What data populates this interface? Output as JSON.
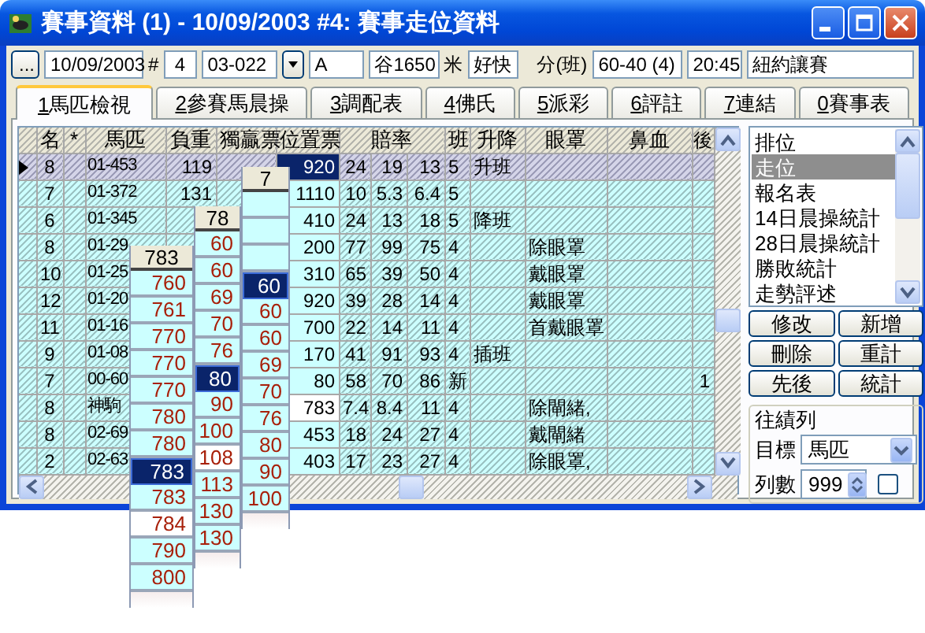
{
  "window": {
    "title": "賽事資料 (1) - 10/09/2003 #4: 賽事走位資料"
  },
  "toolbar": [
    {
      "kind": "button",
      "text": "..."
    },
    {
      "kind": "field",
      "text": "10/09/2003"
    },
    {
      "kind": "label",
      "text": "#"
    },
    {
      "kind": "field",
      "text": "4"
    },
    {
      "kind": "combo",
      "text": "03-022"
    },
    {
      "kind": "field",
      "text": "A"
    },
    {
      "kind": "field",
      "text": "谷1650"
    },
    {
      "kind": "label",
      "text": "米"
    },
    {
      "kind": "field",
      "text": "好快"
    },
    {
      "kind": "label",
      "text": "分(班)"
    },
    {
      "kind": "field",
      "text": "60-40 (4)"
    },
    {
      "kind": "field",
      "text": "20:45"
    },
    {
      "kind": "field",
      "text": "紐約讓賽"
    }
  ],
  "tabs": [
    {
      "key": "1",
      "label": "馬匹檢視",
      "selected": true
    },
    {
      "key": "2",
      "label": "參賽馬晨操",
      "selected": false
    },
    {
      "key": "3",
      "label": "調配表",
      "selected": false
    },
    {
      "key": "4",
      "label": "佛氏",
      "selected": false
    },
    {
      "key": "5",
      "label": "派彩",
      "selected": false
    },
    {
      "key": "6",
      "label": "評註",
      "selected": false
    },
    {
      "key": "7",
      "label": "連結",
      "selected": false
    },
    {
      "key": "0",
      "label": "賽事表",
      "selected": false
    }
  ],
  "table": {
    "columns": [
      "名",
      "*",
      "馬匹",
      "負重",
      "獨贏票",
      "位置票",
      "賠率",
      "班",
      "升降",
      "眼罩",
      "鼻血",
      "後"
    ],
    "rows": [
      {
        "selected": true,
        "number": "8",
        "horse": "01-453",
        "weight": "119",
        "place": {
          "text": "920",
          "selected": true,
          "marked": false
        },
        "odds": [
          "24",
          "19",
          "13"
        ],
        "class": "5",
        "move": "升班"
      },
      {
        "selected": false,
        "number": "7",
        "horse": "01-372",
        "weight": "131",
        "place": {
          "text": "1110",
          "selected": false,
          "marked": false
        },
        "odds": [
          "10",
          "5.3",
          "6.4"
        ],
        "class": "5"
      },
      {
        "selected": false,
        "number": "6",
        "horse": "01-345",
        "place": {
          "text": "410",
          "selected": false,
          "marked": false
        },
        "odds": [
          "24",
          "13",
          "18"
        ],
        "class": "5",
        "move": "降班"
      },
      {
        "selected": false,
        "number": "8",
        "horse": "01-29",
        "place": {
          "text": "200",
          "selected": false,
          "marked": false
        },
        "odds": [
          "77",
          "99",
          "75"
        ],
        "class": "4",
        "blinkers": "除眼罩"
      },
      {
        "selected": false,
        "number": "10",
        "horse": "01-25",
        "place": {
          "text": "310",
          "selected": false,
          "marked": false
        },
        "odds": [
          "65",
          "39",
          "50"
        ],
        "class": "4",
        "blinkers": "戴眼罩"
      },
      {
        "selected": false,
        "number": "12",
        "horse": "01-20",
        "place": {
          "text": "920",
          "selected": false,
          "marked": false
        },
        "odds": [
          "39",
          "28",
          "14"
        ],
        "class": "4",
        "blinkers": "戴眼罩"
      },
      {
        "selected": false,
        "number": "11",
        "horse": "01-16",
        "place": {
          "text": "700",
          "selected": false,
          "marked": false
        },
        "odds": [
          "22",
          "14",
          "11"
        ],
        "class": "4",
        "blinkers": "首戴眼罩"
      },
      {
        "selected": false,
        "number": "9",
        "horse": "01-08",
        "place": {
          "text": "170",
          "selected": false,
          "marked": false
        },
        "odds": [
          "41",
          "91",
          "93"
        ],
        "class": "4",
        "move": "插班"
      },
      {
        "selected": false,
        "number": "7",
        "horse": "00-60",
        "place": {
          "text": "80",
          "selected": false,
          "marked": false
        },
        "odds": [
          "58",
          "70",
          "86"
        ],
        "class": "新",
        "after": "1"
      },
      {
        "selected": false,
        "number": "8",
        "horse": "神駒",
        "place": {
          "text": "783",
          "selected": false,
          "marked": true
        },
        "odds": [
          "7.4",
          "8.4",
          "11"
        ],
        "class": "4",
        "blinkers": "除閘緒,"
      },
      {
        "selected": false,
        "number": "8",
        "horse": "02-69",
        "place": {
          "text": "453",
          "selected": false,
          "marked": false
        },
        "odds": [
          "18",
          "24",
          "27"
        ],
        "class": "4",
        "blinkers": "戴閘緒"
      },
      {
        "selected": false,
        "number": "2",
        "horse": "02-63",
        "place": {
          "text": "403",
          "selected": false,
          "marked": false
        },
        "odds": [
          "17",
          "23",
          "27"
        ],
        "class": "4",
        "blinkers": "除眼罩,"
      }
    ]
  },
  "dropdown_lists": [
    {
      "header": "783",
      "items": [
        {
          "kind": "value",
          "text": "760",
          "selected": false,
          "hovered": false
        },
        {
          "kind": "value",
          "text": "761",
          "selected": false,
          "hovered": false
        },
        {
          "kind": "value",
          "text": "770",
          "selected": false,
          "hovered": false
        },
        {
          "kind": "value",
          "text": "770",
          "selected": false,
          "hovered": false
        },
        {
          "kind": "value",
          "text": "770",
          "selected": false,
          "hovered": false
        },
        {
          "kind": "value",
          "text": "780",
          "selected": false,
          "hovered": false
        },
        {
          "kind": "value",
          "text": "780",
          "selected": false,
          "hovered": false
        },
        {
          "kind": "value",
          "text": "783",
          "selected": true,
          "hovered": false
        },
        {
          "kind": "value",
          "text": "783",
          "selected": false,
          "hovered": false
        },
        {
          "kind": "value",
          "text": "784",
          "selected": false,
          "hovered": true
        },
        {
          "kind": "value",
          "text": "790",
          "selected": false,
          "hovered": false
        },
        {
          "kind": "value",
          "text": "800",
          "selected": false,
          "hovered": false
        }
      ]
    },
    {
      "header": "78",
      "items": [
        {
          "kind": "value",
          "text": "60",
          "selected": false,
          "hovered": false
        },
        {
          "kind": "value",
          "text": "60",
          "selected": false,
          "hovered": false
        },
        {
          "kind": "value",
          "text": "69",
          "selected": false,
          "hovered": false
        },
        {
          "kind": "value",
          "text": "70",
          "selected": false,
          "hovered": false
        },
        {
          "kind": "value",
          "text": "76",
          "selected": false,
          "hovered": false
        },
        {
          "kind": "value",
          "text": "80",
          "selected": true,
          "hovered": false
        },
        {
          "kind": "value",
          "text": "90",
          "selected": false,
          "hovered": false
        },
        {
          "kind": "value",
          "text": "100",
          "selected": false,
          "hovered": false
        },
        {
          "kind": "value",
          "text": "108",
          "selected": false,
          "hovered": true
        },
        {
          "kind": "value",
          "text": "113",
          "selected": false,
          "hovered": false
        },
        {
          "kind": "value",
          "text": "130",
          "selected": false,
          "hovered": false
        },
        {
          "kind": "value",
          "text": "130",
          "selected": false,
          "hovered": false
        }
      ]
    },
    {
      "header": "7",
      "items": [
        {
          "kind": "empty",
          "selected": false,
          "hovered": false
        },
        {
          "kind": "empty",
          "selected": false,
          "hovered": false
        },
        {
          "kind": "empty",
          "selected": false,
          "hovered": false
        },
        {
          "kind": "value",
          "text": "60",
          "selected": true,
          "hovered": false
        },
        {
          "kind": "value",
          "text": "60",
          "selected": false,
          "hovered": false
        },
        {
          "kind": "value",
          "text": "60",
          "selected": false,
          "hovered": false
        },
        {
          "kind": "value",
          "text": "69",
          "selected": false,
          "hovered": false
        },
        {
          "kind": "value",
          "text": "70",
          "selected": false,
          "hovered": false
        },
        {
          "kind": "value",
          "text": "76",
          "selected": false,
          "hovered": false
        },
        {
          "kind": "value",
          "text": "80",
          "selected": false,
          "hovered": false
        },
        {
          "kind": "value",
          "text": "90",
          "selected": false,
          "hovered": false
        },
        {
          "kind": "value",
          "text": "100",
          "selected": false,
          "hovered": false
        }
      ]
    }
  ],
  "side_panel": {
    "list": [
      {
        "label": "排位",
        "selected": false
      },
      {
        "label": "走位",
        "selected": true
      },
      {
        "label": "報名表",
        "selected": false
      },
      {
        "label": "14日晨操統計",
        "selected": false
      },
      {
        "label": "28日晨操統計",
        "selected": false
      },
      {
        "label": "勝敗統計",
        "selected": false
      },
      {
        "label": "走勢評述",
        "selected": false
      }
    ],
    "buttons": [
      "修改",
      "新增",
      "刪除",
      "重計",
      "先後",
      "統計"
    ],
    "group": {
      "title": "往績列",
      "target_label": "目標",
      "target": "馬匹",
      "rows_label": "列數",
      "rows": "999",
      "checked": false
    }
  }
}
